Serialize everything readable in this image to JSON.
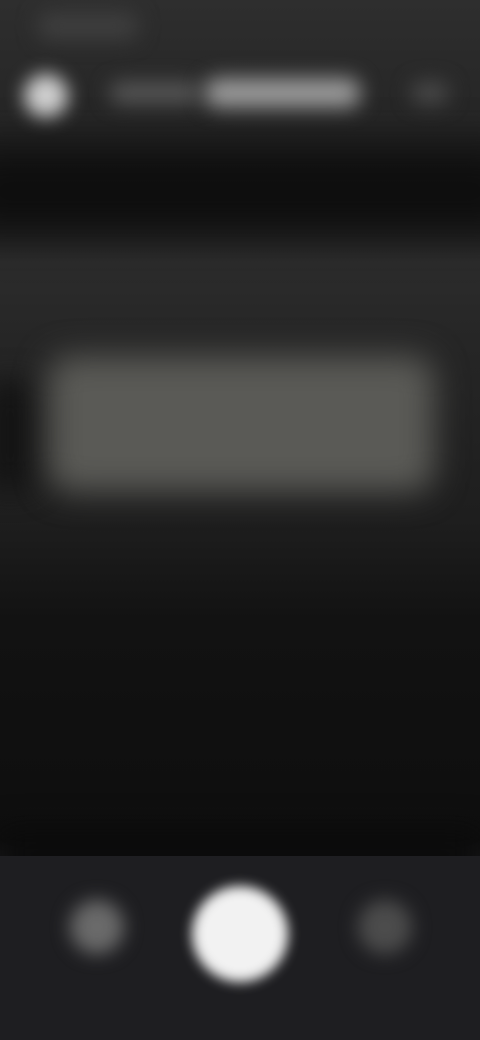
{
  "screen": {
    "state": "blurred",
    "background_color": "#141414"
  },
  "status_bar": {
    "time_text": ""
  },
  "app_bar": {
    "icon": "app-icon",
    "title": ""
  },
  "content": {
    "card_text": ""
  },
  "controls": {
    "left_icon": "circle-button-icon",
    "center_icon": "shutter-button-icon",
    "right_icon": "circle-button-icon",
    "shutter_color": "#f2f2f2"
  }
}
